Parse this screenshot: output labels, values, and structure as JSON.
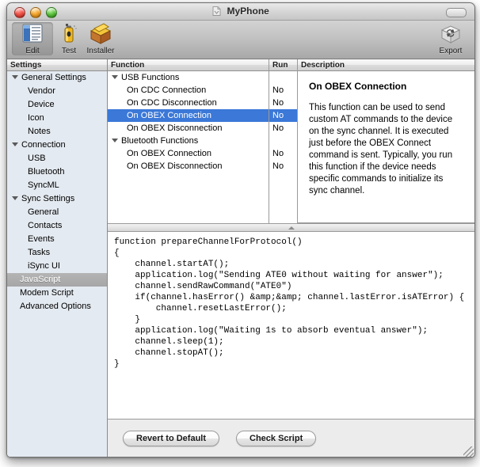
{
  "window": {
    "title": "MyPhone",
    "proxy_icon": "document-proxy-icon",
    "controls": {
      "close": "close-button",
      "minimize": "minimize-button",
      "zoom": "zoom-button",
      "toolbar_toggle": "toolbar-toggle-button"
    }
  },
  "toolbar": {
    "items": [
      {
        "label": "Edit",
        "icon": "list-edit-icon",
        "selected": true
      },
      {
        "label": "Test",
        "icon": "spray-can-icon",
        "selected": false
      },
      {
        "label": "Installer",
        "icon": "package-box-icon",
        "selected": false
      }
    ],
    "export": {
      "label": "Export",
      "icon": "export-sync-box-icon"
    }
  },
  "sidebar": {
    "header": "Settings",
    "items": [
      {
        "label": "General Settings",
        "type": "group",
        "expanded": true,
        "selected": false
      },
      {
        "label": "Vendor",
        "type": "child",
        "selected": false
      },
      {
        "label": "Device",
        "type": "child",
        "selected": false
      },
      {
        "label": "Icon",
        "type": "child",
        "selected": false
      },
      {
        "label": "Notes",
        "type": "child",
        "selected": false
      },
      {
        "label": "Connection",
        "type": "group",
        "expanded": true,
        "selected": false
      },
      {
        "label": "USB",
        "type": "child",
        "selected": false
      },
      {
        "label": "Bluetooth",
        "type": "child",
        "selected": false
      },
      {
        "label": "SyncML",
        "type": "child",
        "selected": false
      },
      {
        "label": "Sync Settings",
        "type": "group",
        "expanded": true,
        "selected": false
      },
      {
        "label": "General",
        "type": "child",
        "selected": false
      },
      {
        "label": "Contacts",
        "type": "child",
        "selected": false
      },
      {
        "label": "Events",
        "type": "child",
        "selected": false
      },
      {
        "label": "Tasks",
        "type": "child",
        "selected": false
      },
      {
        "label": "iSync UI",
        "type": "child",
        "selected": false
      },
      {
        "label": "JavaScript",
        "type": "flat",
        "selected": true
      },
      {
        "label": "Modem Script",
        "type": "flat",
        "selected": false
      },
      {
        "label": "Advanced Options",
        "type": "flat",
        "selected": false
      }
    ]
  },
  "function_table": {
    "columns": {
      "function": "Function",
      "run": "Run",
      "description": "Description"
    },
    "rows": [
      {
        "label": "USB Functions",
        "type": "group",
        "expanded": true,
        "run": "",
        "selected": false
      },
      {
        "label": "On CDC Connection",
        "type": "child",
        "run": "No",
        "selected": false
      },
      {
        "label": "On CDC Disconnection",
        "type": "child",
        "run": "No",
        "selected": false
      },
      {
        "label": "On OBEX Connection",
        "type": "child",
        "run": "No",
        "selected": true
      },
      {
        "label": "On OBEX Disconnection",
        "type": "child",
        "run": "No",
        "selected": false
      },
      {
        "label": "Bluetooth Functions",
        "type": "group",
        "expanded": true,
        "run": "",
        "selected": false
      },
      {
        "label": "On OBEX Connection",
        "type": "child",
        "run": "No",
        "selected": false
      },
      {
        "label": "On OBEX Disconnection",
        "type": "child",
        "run": "No",
        "selected": false
      }
    ]
  },
  "description": {
    "title": "On OBEX Connection",
    "text": "This function can be used to send custom AT commands to the device on the sync channel. It is executed just before the OBEX Connect command is sent. Typically, you run this function if the device needs specific commands to initialize its sync channel."
  },
  "editor": {
    "code": "function prepareChannelForProtocol()\n{\n    channel.startAT();\n    application.log(\"Sending ATE0 without waiting for answer\");\n    channel.sendRawCommand(\"ATE0\")\n    if(channel.hasError() &amp;&amp; channel.lastError.isATError) {\n        channel.resetLastError();\n    }\n    application.log(\"Waiting 1s to absorb eventual answer\");\n    channel.sleep(1);\n    channel.stopAT();\n}"
  },
  "buttons": {
    "revert": "Revert to Default",
    "check": "Check Script"
  },
  "colors": {
    "selection_blue": "#3b78d8",
    "selection_grey": "#b4b4b4",
    "sidebar_bg": "#e4eaf1"
  }
}
